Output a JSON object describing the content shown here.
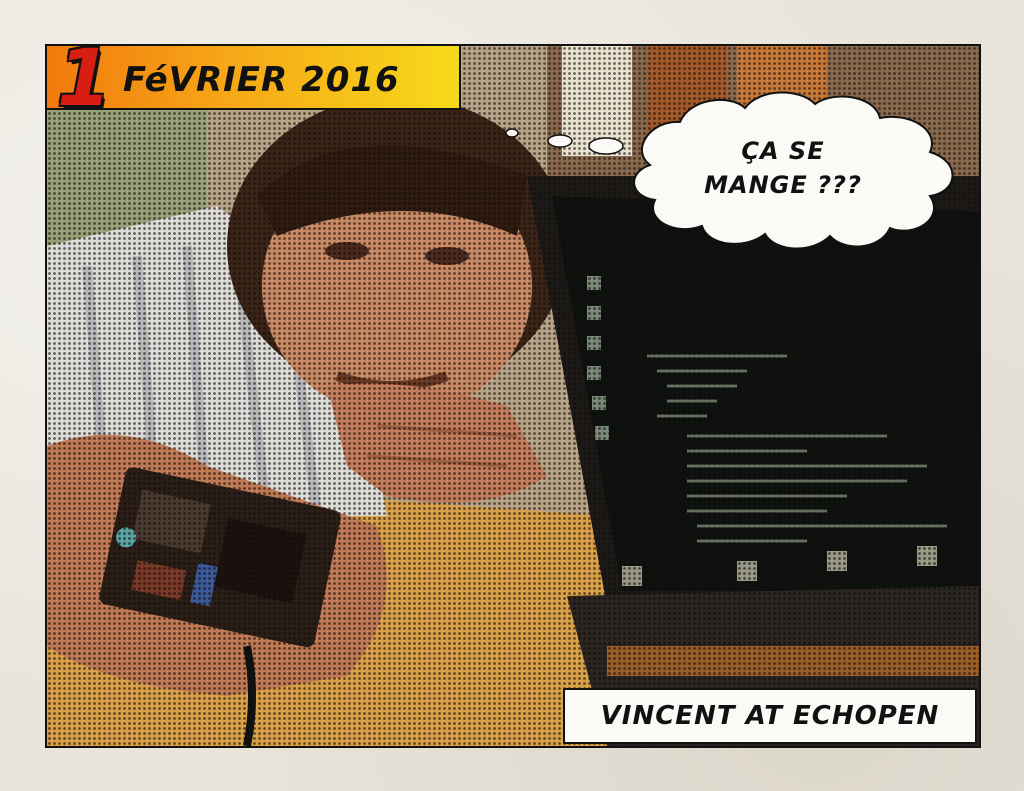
{
  "header": {
    "date_number": "1",
    "date_text": "FéVRIER 2016"
  },
  "speech": {
    "line1": "ÇA SE",
    "line2": "MANGE ???"
  },
  "caption": {
    "text": "VINCENT AT ECHOPEN"
  },
  "colors": {
    "date_gradient_start": "#f27a0e",
    "date_gradient_end": "#f6da1a",
    "date_number": "#d81d12",
    "caption_bg": "#fbfaf6"
  }
}
